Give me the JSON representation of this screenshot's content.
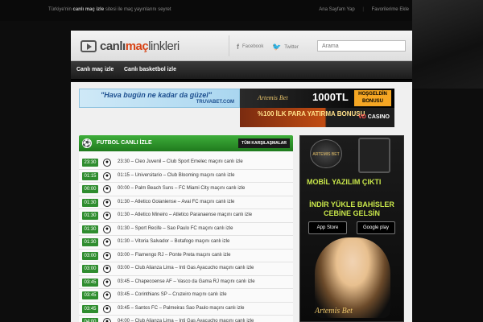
{
  "topbar": {
    "tagline_prefix": "Türkiye'nin",
    "tagline_bold": "canlı maç izle",
    "tagline_suffix": "sitesi ile maç yayınlarını seyret",
    "links": [
      "Ana Sayfam Yap",
      "|",
      "Favorilerime Ekle"
    ]
  },
  "header": {
    "logo_part1": "canlı",
    "logo_part2": "maç",
    "logo_part3": "linkleri",
    "facebook_icon": "f",
    "facebook_label": "Facebook",
    "twitter_icon": "🐦",
    "twitter_label": "Twitter",
    "search_placeholder": "Arama"
  },
  "nav": {
    "items": [
      "Canlı maç izle",
      "Canlı basketbol izle"
    ]
  },
  "banners": {
    "b1_text": "\"Hava bugün ne kadar da güzel\"",
    "b1_brand": "TRUVABET.COM",
    "b2_brand": "Artemis Bet",
    "b2_big": "1000TL",
    "b2_bonus": "HOŞGELDİN BONUSU",
    "b3_text": "%100 İLK PARA YATIRMA BONUSU",
    "b3_vd1": "VD",
    "b3_vd2": "CASINO"
  },
  "panel": {
    "title": "FUTBOL CANLI İZLE",
    "all_label": "TÜM KARŞILAŞMALAR",
    "matches": [
      {
        "time": "23:30",
        "name": "23:30 – Cleo Juvenil – Club Sport Emelec maçını canlı izle"
      },
      {
        "time": "01:15",
        "name": "01:15 – Universitario – Club Blooming maçını canlı izle"
      },
      {
        "time": "00:00",
        "name": "00:00 – Palm Beach Suns – FC Miami City maçını canlı izle"
      },
      {
        "time": "01:30",
        "name": "01:30 – Atletico Goianiense – Avai FC maçını canlı izle"
      },
      {
        "time": "01:30",
        "name": "01:30 – Atletico Mineiro – Atletico Paranaense maçını canlı izle"
      },
      {
        "time": "01:30",
        "name": "01:30 – Sport Recife – Sao Paulo FC maçını canlı izle"
      },
      {
        "time": "01:30",
        "name": "01:30 – Vitoria Salvador – Botafogo maçını canlı izle"
      },
      {
        "time": "03:00",
        "name": "03:00 – Flamengo RJ – Ponte Preta maçını canlı izle"
      },
      {
        "time": "03:00",
        "name": "03:00 – Club Alianza Lima – Inti Gas Ayacucho maçını canlı izle"
      },
      {
        "time": "03:45",
        "name": "03:45 – Chapecoense AF – Vasco da Gama RJ maçını canlı izle"
      },
      {
        "time": "03:45",
        "name": "03:45 – Corinthians SP – Cruzeiro maçını canlı izle"
      },
      {
        "time": "03:45",
        "name": "03:45 – Santos FC – Palmeiras Sao Paulo maçını canlı izle"
      },
      {
        "time": "04:00",
        "name": "04:00 – Club Alianza Lima – Inti Gas Ayacucho maçını canlı izle"
      }
    ]
  },
  "sidebar_ad": {
    "logo": "ARTEMIS BET",
    "mobil": "MOBİL YAZILIM ÇIKTI",
    "indir": "İNDİR YÜKLE BAHİSLER CEBİNE GELSİN",
    "app_store": "App Store",
    "google_play": "Google play",
    "brand": "Artemis Bet"
  }
}
